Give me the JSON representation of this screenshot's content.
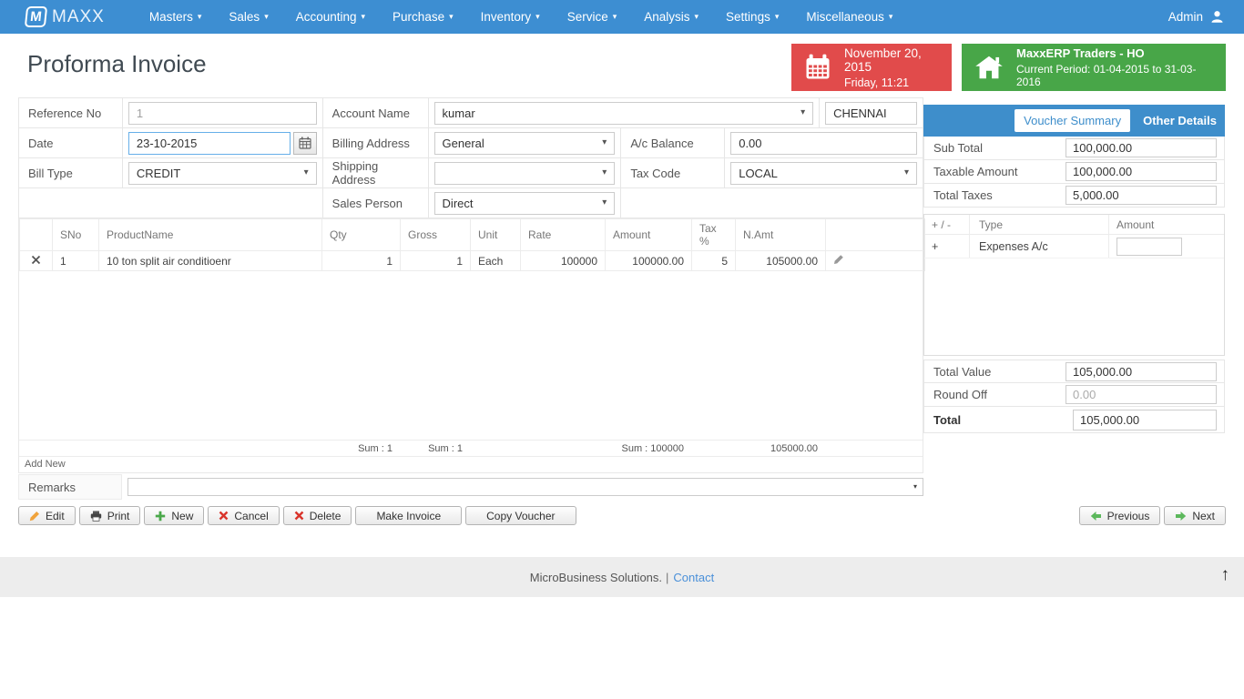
{
  "nav": {
    "brand": "MAXX",
    "logo_letter": "M",
    "items": [
      "Masters",
      "Sales",
      "Accounting",
      "Purchase",
      "Inventory",
      "Service",
      "Analysis",
      "Settings",
      "Miscellaneous"
    ],
    "user": "Admin"
  },
  "header": {
    "title": "Proforma Invoice",
    "date_box": {
      "date": "November 20, 2015",
      "day_time": "Friday, 11:21"
    },
    "company_box": {
      "name": "MaxxERP Traders - HO",
      "period": "Current Period: 01-04-2015 to 31-03-2016"
    }
  },
  "form": {
    "reference_no_label": "Reference No",
    "reference_no_value": "1",
    "date_label": "Date",
    "date_value": "23-10-2015",
    "bill_type_label": "Bill Type",
    "bill_type_value": "CREDIT",
    "account_name_label": "Account Name",
    "account_name_value": "kumar",
    "account_city_value": "CHENNAI",
    "billing_address_label": "Billing Address",
    "billing_address_value": "General",
    "shipping_address_label": "Shipping Address",
    "shipping_address_value": "",
    "sales_person_label": "Sales Person",
    "sales_person_value": "Direct",
    "ac_balance_label": "A/c Balance",
    "ac_balance_value": "0.00",
    "tax_code_label": "Tax Code",
    "tax_code_value": "LOCAL"
  },
  "items_table": {
    "headers": [
      "SNo",
      "ProductName",
      "Qty",
      "Gross",
      "Unit",
      "Rate",
      "Amount",
      "Tax %",
      "N.Amt"
    ],
    "rows": [
      {
        "sno": "1",
        "product": "10 ton split air conditioenr",
        "qty": "1",
        "gross": "1",
        "unit": "Each",
        "rate": "100000",
        "amount": "100000.00",
        "tax_pct": "5",
        "n_amt": "105000.00"
      }
    ],
    "sum_qty": "Sum : 1",
    "sum_gross": "Sum : 1",
    "sum_amount": "Sum : 100000",
    "sum_n_amt": "105000.00",
    "add_new_label": "Add New"
  },
  "remarks": {
    "label": "Remarks",
    "value": ""
  },
  "summary": {
    "tab_voucher": "Voucher Summary",
    "tab_other": "Other Details",
    "sub_total_label": "Sub Total",
    "sub_total_value": "100,000.00",
    "taxable_label": "Taxable Amount",
    "taxable_value": "100,000.00",
    "total_taxes_label": "Total Taxes",
    "total_taxes_value": "5,000.00",
    "adjust": {
      "col_sign": "+ / -",
      "col_type": "Type",
      "col_amount": "Amount",
      "rows": [
        {
          "sign": "+",
          "type": "Expenses A/c",
          "amount": ""
        }
      ]
    },
    "total_value_label": "Total Value",
    "total_value_amount": "105,000.00",
    "round_off_label": "Round Off",
    "round_off_value": "0.00",
    "total_label": "Total",
    "total_amount": "105,000.00"
  },
  "toolbar": {
    "edit": "Edit",
    "print": "Print",
    "new": "New",
    "cancel": "Cancel",
    "delete": "Delete",
    "make_invoice": "Make Invoice",
    "copy_voucher": "Copy Voucher",
    "previous": "Previous",
    "next": "Next"
  },
  "footer": {
    "text": "MicroBusiness Solutions.",
    "separator": "|",
    "contact": "Contact"
  },
  "colors": {
    "nav_blue": "#3d8ed2",
    "panel_blue": "#3e8ecb",
    "date_red": "#e14b4b",
    "company_green": "#48a648",
    "link_blue": "#4a90d9",
    "edit_orange": "#f0a33c",
    "action_green": "#4aa84a",
    "action_red": "#d9342b"
  }
}
